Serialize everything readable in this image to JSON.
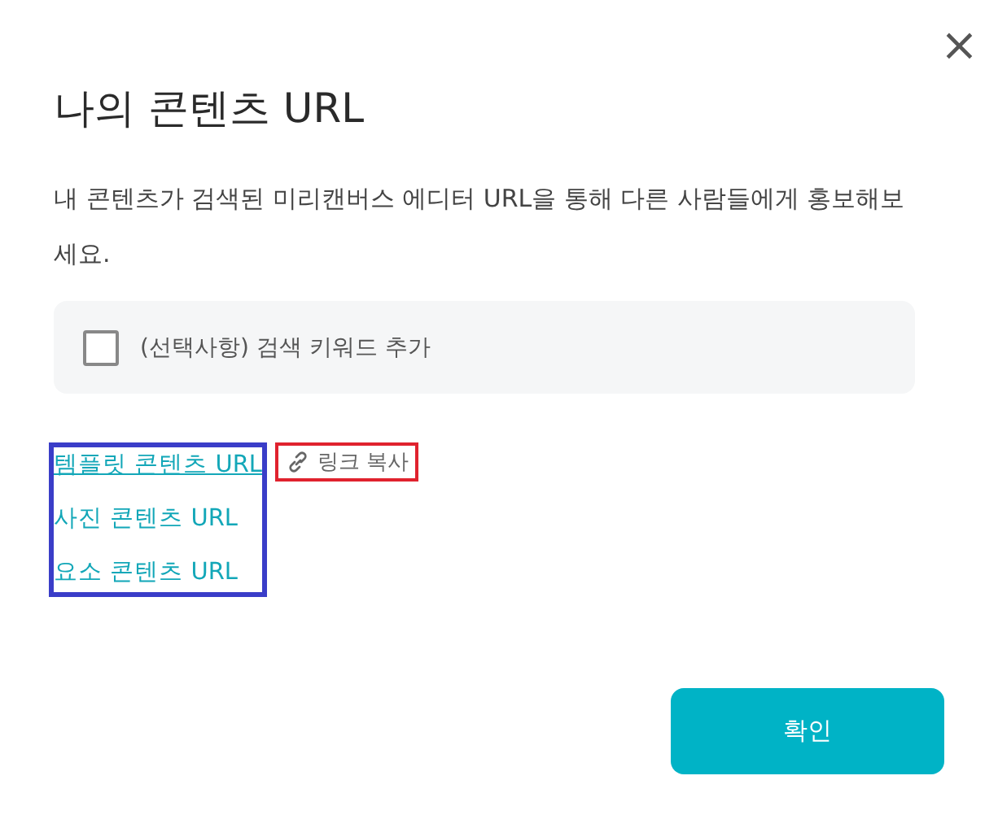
{
  "dialog": {
    "title": "나의 콘텐츠 URL",
    "close": "×",
    "description": "내 콘텐츠가 검색된 미리캔버스 에디터 URL을 통해 다른 사람들에게 홍보해보세요.",
    "option": {
      "label": "(선택사항) 검색 키워드 추가",
      "checked": false
    },
    "links": [
      {
        "label": "템플릿 콘텐츠 URL",
        "underlined": true
      },
      {
        "label": "사진 콘텐츠 URL",
        "underlined": false
      },
      {
        "label": "요소 콘텐츠 URL",
        "underlined": false
      }
    ],
    "highlights": [
      {
        "color": "#3a3dc8"
      },
      {
        "color": "#e0222e"
      }
    ],
    "copy": {
      "label": "링크 복사"
    },
    "confirm": "확인"
  }
}
